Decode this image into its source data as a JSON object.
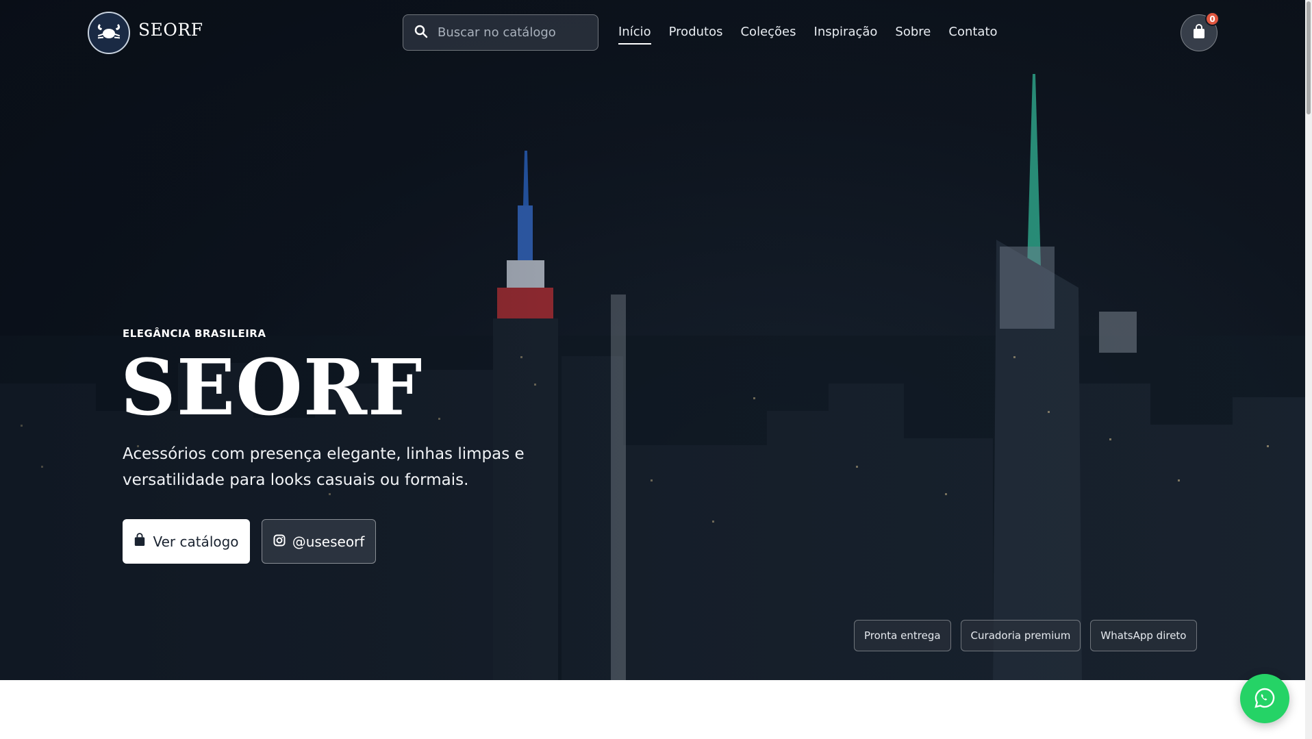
{
  "header": {
    "brand_name": "SEORF",
    "search_placeholder": "Buscar no catálogo",
    "nav": [
      {
        "label": "Início",
        "active": true
      },
      {
        "label": "Produtos",
        "active": false
      },
      {
        "label": "Coleções",
        "active": false
      },
      {
        "label": "Inspiração",
        "active": false
      },
      {
        "label": "Sobre",
        "active": false
      },
      {
        "label": "Contato",
        "active": false
      }
    ],
    "cart_count": "0"
  },
  "hero": {
    "eyebrow": "ELEGÂNCIA BRASILEIRA",
    "title": "SEORF",
    "subtitle": "Acessórios com presença elegante, linhas limpas e versatilidade para looks casuais ou formais.",
    "primary_button": "Ver catálogo",
    "secondary_button": "@useseorf",
    "chips": [
      "Pronta entrega",
      "Curadoria premium",
      "WhatsApp direto"
    ]
  },
  "icons": {
    "logo": "crab-icon",
    "search": "search-icon",
    "cart": "shopping-bag-icon",
    "primary_button": "shopping-bag-icon",
    "secondary_button": "instagram-icon",
    "float": "whatsapp-icon"
  },
  "colors": {
    "hero_bg": "#0f1620",
    "accent_white": "#ffffff",
    "cart_badge": "#e0563f",
    "whatsapp": "#25d366"
  }
}
